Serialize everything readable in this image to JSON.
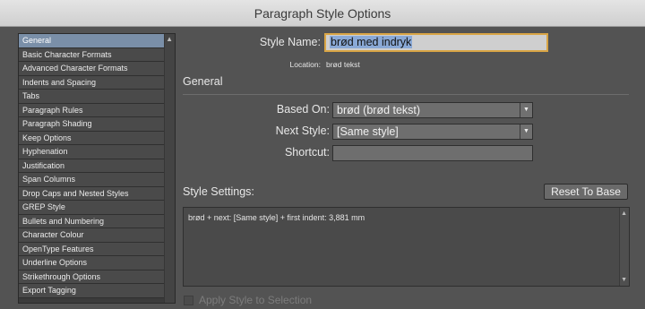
{
  "window": {
    "title": "Paragraph Style Options"
  },
  "sidebar": {
    "items": [
      {
        "label": "General",
        "selected": true
      },
      {
        "label": "Basic Character Formats"
      },
      {
        "label": "Advanced Character Formats"
      },
      {
        "label": "Indents and Spacing"
      },
      {
        "label": "Tabs"
      },
      {
        "label": "Paragraph Rules"
      },
      {
        "label": "Paragraph Shading"
      },
      {
        "label": "Keep Options"
      },
      {
        "label": "Hyphenation"
      },
      {
        "label": "Justification"
      },
      {
        "label": "Span Columns"
      },
      {
        "label": "Drop Caps and Nested Styles"
      },
      {
        "label": "GREP Style"
      },
      {
        "label": "Bullets and Numbering"
      },
      {
        "label": "Character Colour"
      },
      {
        "label": "OpenType Features"
      },
      {
        "label": "Underline Options"
      },
      {
        "label": "Strikethrough Options"
      },
      {
        "label": "Export Tagging"
      }
    ]
  },
  "form": {
    "style_name_label": "Style Name:",
    "style_name_value": "brød med indryk",
    "location_label": "Location:",
    "location_value": "brød tekst",
    "section_title": "General",
    "based_on_label": "Based On:",
    "based_on_value": "brød (brød tekst)",
    "next_style_label": "Next Style:",
    "next_style_value": "[Same style]",
    "shortcut_label": "Shortcut:",
    "shortcut_value": "",
    "style_settings_label": "Style Settings:",
    "reset_button": "Reset To Base",
    "settings_text": "brød + next: [Same style] + first indent: 3,881 mm",
    "apply_label": "Apply Style to Selection"
  },
  "colors": {
    "selection_highlight": "#7a8fa8",
    "focus_ring": "#d9a545",
    "text_selection": "#8aa9d6"
  }
}
